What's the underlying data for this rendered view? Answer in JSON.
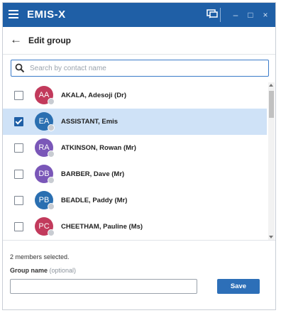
{
  "app": {
    "brand": "EMIS-X",
    "window_controls": {
      "minimize": "–",
      "maximize": "□",
      "close": "×"
    }
  },
  "header": {
    "back_icon": "arrow-left-icon",
    "title": "Edit group"
  },
  "search": {
    "placeholder": "Search by contact name",
    "value": ""
  },
  "contacts": [
    {
      "initials": "AA",
      "name": "AKALA, Adesoji (Dr)",
      "checked": false,
      "avatar_color": "#c23a5c"
    },
    {
      "initials": "EA",
      "name": "ASSISTANT, Emis",
      "checked": true,
      "avatar_color": "#2a6fb1"
    },
    {
      "initials": "RA",
      "name": "ATKINSON, Rowan (Mr)",
      "checked": false,
      "avatar_color": "#7a57b8"
    },
    {
      "initials": "DB",
      "name": "BARBER, Dave (Mr)",
      "checked": false,
      "avatar_color": "#7a57b8"
    },
    {
      "initials": "PB",
      "name": "BEADLE, Paddy (Mr)",
      "checked": false,
      "avatar_color": "#2a6fb1"
    },
    {
      "initials": "PC",
      "name": "CHEETHAM, Pauline (Ms)",
      "checked": false,
      "avatar_color": "#c23a5c"
    }
  ],
  "footer": {
    "selected_count": "2 members selected.",
    "group_name_label": "Group name",
    "group_name_optional": "(optional)",
    "group_name_value": "",
    "save_label": "Save"
  },
  "colors": {
    "titlebar": "#1f5fa6",
    "accent": "#2d6fb8",
    "selected_row": "#cfe2f7"
  }
}
